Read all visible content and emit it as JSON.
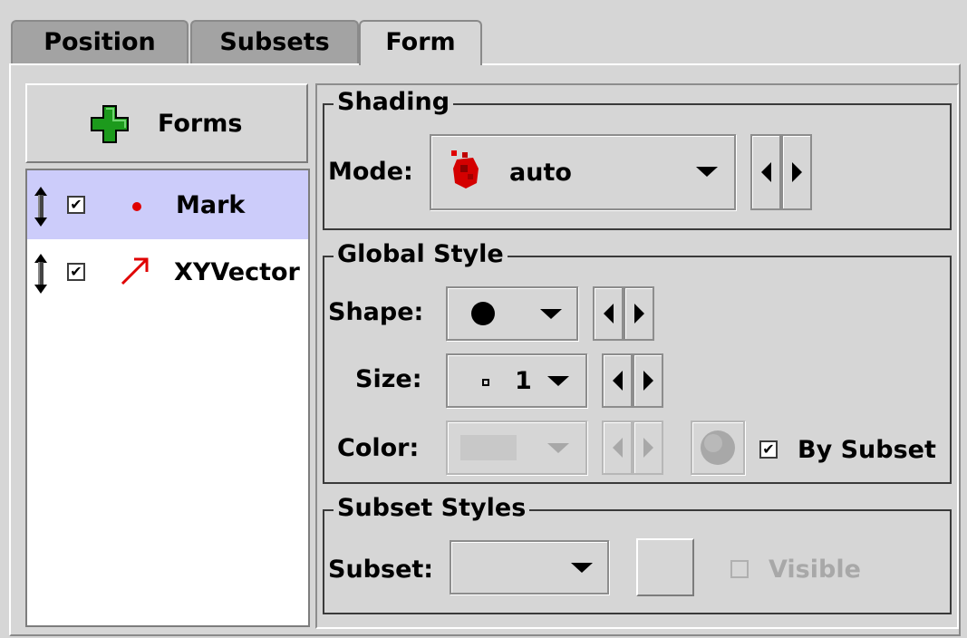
{
  "tabs": [
    {
      "label": "Position",
      "active": false
    },
    {
      "label": "Subsets",
      "active": false
    },
    {
      "label": "Form",
      "active": true
    }
  ],
  "forms_button": {
    "label": "Forms",
    "icon": "plus-icon"
  },
  "layers": [
    {
      "label": "Mark",
      "checked": true,
      "selected": true,
      "icon": "red-dot-icon"
    },
    {
      "label": "XYVector",
      "checked": true,
      "selected": false,
      "icon": "red-arrow-icon"
    }
  ],
  "shading": {
    "title": "Shading",
    "mode_label": "Mode:",
    "mode_value": "auto"
  },
  "global_style": {
    "title": "Global Style",
    "shape_label": "Shape:",
    "shape_value": "filled-circle",
    "size_label": "Size:",
    "size_value": "1",
    "color_label": "Color:",
    "by_subset_label": "By Subset",
    "by_subset_checked": true
  },
  "subset_styles": {
    "title": "Subset Styles",
    "subset_label": "Subset:",
    "subset_value": "",
    "visible_label": "Visible",
    "visible_checked": false
  },
  "colors": {
    "selection": "#ccccfa",
    "accent_red": "#e00000",
    "plus_green": "#1c9a1c"
  }
}
